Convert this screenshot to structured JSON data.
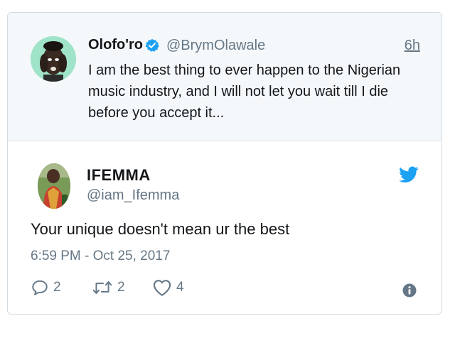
{
  "parent_tweet": {
    "display_name": "Olofo'ro",
    "handle": "@BrymOlawale",
    "time": "6h",
    "text": "I am the best thing to ever happen to the Nigerian music industry, and I will not let you wait till I die before you accept it...",
    "avatar_icon": "avatar-photo-icon",
    "verified_icon": "verified-badge-icon"
  },
  "reply_tweet": {
    "display_name": "IFEMMA",
    "handle": "@iam_Ifemma",
    "text": "Your unique doesn't mean ur the best",
    "timestamp": "6:59 PM - Oct 25, 2017",
    "avatar_icon": "avatar-photo-icon",
    "brand_icon": "twitter-bird-icon"
  },
  "actions": {
    "reply_count": "2",
    "retweet_count": "2",
    "like_count": "4",
    "info_icon": "info-icon"
  },
  "colors": {
    "twitter_blue": "#1da1f2",
    "muted_text": "#657786",
    "parent_bg": "#f5f8fa",
    "border": "#d4dbe0"
  }
}
